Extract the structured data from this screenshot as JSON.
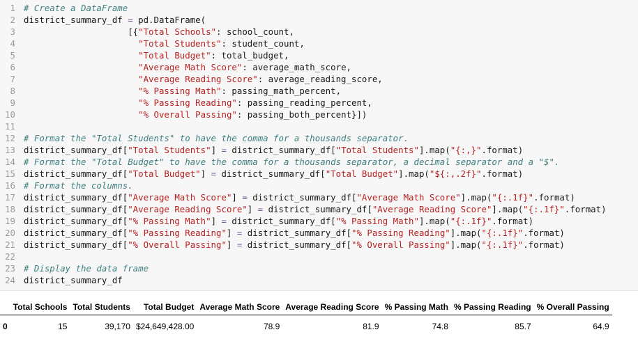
{
  "code_lines": [
    [
      {
        "t": "# Create a DataFrame",
        "k": "cm"
      }
    ],
    [
      {
        "t": "district_summary_df ",
        "k": "p"
      },
      {
        "t": "=",
        "k": "op"
      },
      {
        "t": " pd.DataFrame(",
        "k": "p"
      }
    ],
    [
      {
        "t": "                    [{",
        "k": "p"
      },
      {
        "t": "\"Total Schools\"",
        "k": "str"
      },
      {
        "t": ": school_count,",
        "k": "p"
      }
    ],
    [
      {
        "t": "                      ",
        "k": "p"
      },
      {
        "t": "\"Total Students\"",
        "k": "str"
      },
      {
        "t": ": student_count,",
        "k": "p"
      }
    ],
    [
      {
        "t": "                      ",
        "k": "p"
      },
      {
        "t": "\"Total Budget\"",
        "k": "str"
      },
      {
        "t": ": total_budget,",
        "k": "p"
      }
    ],
    [
      {
        "t": "                      ",
        "k": "p"
      },
      {
        "t": "\"Average Math Score\"",
        "k": "str"
      },
      {
        "t": ": average_math_score,",
        "k": "p"
      }
    ],
    [
      {
        "t": "                      ",
        "k": "p"
      },
      {
        "t": "\"Average Reading Score\"",
        "k": "str"
      },
      {
        "t": ": average_reading_score,",
        "k": "p"
      }
    ],
    [
      {
        "t": "                      ",
        "k": "p"
      },
      {
        "t": "\"% Passing Math\"",
        "k": "str"
      },
      {
        "t": ": passing_math_percent,",
        "k": "p"
      }
    ],
    [
      {
        "t": "                      ",
        "k": "p"
      },
      {
        "t": "\"% Passing Reading\"",
        "k": "str"
      },
      {
        "t": ": passing_reading_percent,",
        "k": "p"
      }
    ],
    [
      {
        "t": "                      ",
        "k": "p"
      },
      {
        "t": "\"% Overall Passing\"",
        "k": "str"
      },
      {
        "t": ": passing_both_percent}])",
        "k": "p"
      }
    ],
    [],
    [
      {
        "t": "# Format the \"Total Students\" to have the comma for a thousands separator.",
        "k": "cm"
      }
    ],
    [
      {
        "t": "district_summary_df[",
        "k": "p"
      },
      {
        "t": "\"Total Students\"",
        "k": "str"
      },
      {
        "t": "] ",
        "k": "p"
      },
      {
        "t": "=",
        "k": "op"
      },
      {
        "t": " district_summary_df[",
        "k": "p"
      },
      {
        "t": "\"Total Students\"",
        "k": "str"
      },
      {
        "t": "].map(",
        "k": "p"
      },
      {
        "t": "\"{:,}\"",
        "k": "str"
      },
      {
        "t": ".format)",
        "k": "p"
      }
    ],
    [
      {
        "t": "# Format the \"Total Budget\" to have the comma for a thousands separator, a decimal separator and a \"$\".",
        "k": "cm"
      }
    ],
    [
      {
        "t": "district_summary_df[",
        "k": "p"
      },
      {
        "t": "\"Total Budget\"",
        "k": "str"
      },
      {
        "t": "] ",
        "k": "p"
      },
      {
        "t": "=",
        "k": "op"
      },
      {
        "t": " district_summary_df[",
        "k": "p"
      },
      {
        "t": "\"Total Budget\"",
        "k": "str"
      },
      {
        "t": "].map(",
        "k": "p"
      },
      {
        "t": "\"${:,.2f}\"",
        "k": "str"
      },
      {
        "t": ".format)",
        "k": "p"
      }
    ],
    [
      {
        "t": "# Format the columns.",
        "k": "cm"
      }
    ],
    [
      {
        "t": "district_summary_df[",
        "k": "p"
      },
      {
        "t": "\"Average Math Score\"",
        "k": "str"
      },
      {
        "t": "] ",
        "k": "p"
      },
      {
        "t": "=",
        "k": "op"
      },
      {
        "t": " district_summary_df[",
        "k": "p"
      },
      {
        "t": "\"Average Math Score\"",
        "k": "str"
      },
      {
        "t": "].map(",
        "k": "p"
      },
      {
        "t": "\"{:.1f}\"",
        "k": "str"
      },
      {
        "t": ".format)",
        "k": "p"
      }
    ],
    [
      {
        "t": "district_summary_df[",
        "k": "p"
      },
      {
        "t": "\"Average Reading Score\"",
        "k": "str"
      },
      {
        "t": "] ",
        "k": "p"
      },
      {
        "t": "=",
        "k": "op"
      },
      {
        "t": " district_summary_df[",
        "k": "p"
      },
      {
        "t": "\"Average Reading Score\"",
        "k": "str"
      },
      {
        "t": "].map(",
        "k": "p"
      },
      {
        "t": "\"{:.1f}\"",
        "k": "str"
      },
      {
        "t": ".format)",
        "k": "p"
      }
    ],
    [
      {
        "t": "district_summary_df[",
        "k": "p"
      },
      {
        "t": "\"% Passing Math\"",
        "k": "str"
      },
      {
        "t": "] ",
        "k": "p"
      },
      {
        "t": "=",
        "k": "op"
      },
      {
        "t": " district_summary_df[",
        "k": "p"
      },
      {
        "t": "\"% Passing Math\"",
        "k": "str"
      },
      {
        "t": "].map(",
        "k": "p"
      },
      {
        "t": "\"{:.1f}\"",
        "k": "str"
      },
      {
        "t": ".format)",
        "k": "p"
      }
    ],
    [
      {
        "t": "district_summary_df[",
        "k": "p"
      },
      {
        "t": "\"% Passing Reading\"",
        "k": "str"
      },
      {
        "t": "] ",
        "k": "p"
      },
      {
        "t": "=",
        "k": "op"
      },
      {
        "t": " district_summary_df[",
        "k": "p"
      },
      {
        "t": "\"% Passing Reading\"",
        "k": "str"
      },
      {
        "t": "].map(",
        "k": "p"
      },
      {
        "t": "\"{:.1f}\"",
        "k": "str"
      },
      {
        "t": ".format)",
        "k": "p"
      }
    ],
    [
      {
        "t": "district_summary_df[",
        "k": "p"
      },
      {
        "t": "\"% Overall Passing\"",
        "k": "str"
      },
      {
        "t": "] ",
        "k": "p"
      },
      {
        "t": "=",
        "k": "op"
      },
      {
        "t": " district_summary_df[",
        "k": "p"
      },
      {
        "t": "\"% Overall Passing\"",
        "k": "str"
      },
      {
        "t": "].map(",
        "k": "p"
      },
      {
        "t": "\"{:.1f}\"",
        "k": "str"
      },
      {
        "t": ".format)",
        "k": "p"
      }
    ],
    [],
    [
      {
        "t": "# Display the data frame",
        "k": "cm"
      }
    ],
    [
      {
        "t": "district_summary_df",
        "k": "p"
      }
    ]
  ],
  "output_table": {
    "columns": [
      "",
      "Total Schools",
      "Total Students",
      "Total Budget",
      "Average Math Score",
      "Average Reading Score",
      "% Passing Math",
      "% Passing Reading",
      "% Overall Passing"
    ],
    "rows": [
      [
        "0",
        "15",
        "39,170",
        "$24,649,428.00",
        "78.9",
        "81.9",
        "74.8",
        "85.7",
        "64.9"
      ]
    ]
  }
}
